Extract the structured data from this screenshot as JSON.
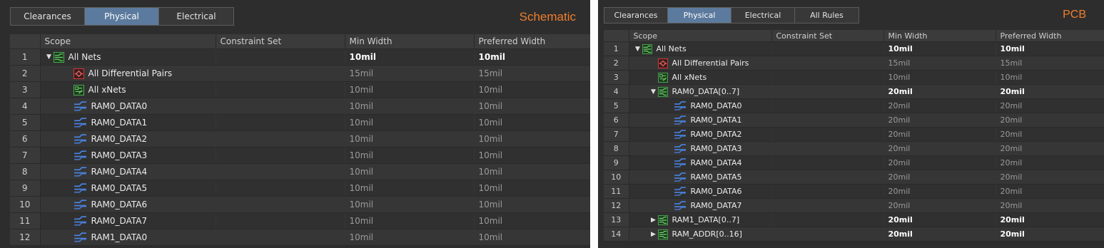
{
  "schematic": {
    "mode_label": "Schematic",
    "tabs": [
      {
        "label": "Clearances",
        "active": false
      },
      {
        "label": "Physical",
        "active": true
      },
      {
        "label": "Electrical",
        "active": false
      }
    ],
    "columns": [
      "Scope",
      "Constraint Set",
      "Min Width",
      "Preferred Width"
    ],
    "rows": [
      {
        "num": "1",
        "name": "All Nets",
        "icon": "net-class-icon",
        "expander": "down",
        "indent": 0,
        "min": "10mil",
        "pref": "10mil",
        "bright": true
      },
      {
        "num": "2",
        "name": "All Differential Pairs",
        "icon": "differential-pair-icon",
        "expander": "",
        "indent": 1,
        "min": "15mil",
        "pref": "15mil",
        "bright": false
      },
      {
        "num": "3",
        "name": "All xNets",
        "icon": "xnet-icon",
        "expander": "",
        "indent": 1,
        "min": "10mil",
        "pref": "10mil",
        "bright": false
      },
      {
        "num": "4",
        "name": "RAM0_DATA0",
        "icon": "net-icon",
        "expander": "",
        "indent": 1,
        "min": "10mil",
        "pref": "10mil",
        "bright": false
      },
      {
        "num": "5",
        "name": "RAM0_DATA1",
        "icon": "net-icon",
        "expander": "",
        "indent": 1,
        "min": "10mil",
        "pref": "10mil",
        "bright": false
      },
      {
        "num": "6",
        "name": "RAM0_DATA2",
        "icon": "net-icon",
        "expander": "",
        "indent": 1,
        "min": "10mil",
        "pref": "10mil",
        "bright": false
      },
      {
        "num": "7",
        "name": "RAM0_DATA3",
        "icon": "net-icon",
        "expander": "",
        "indent": 1,
        "min": "10mil",
        "pref": "10mil",
        "bright": false
      },
      {
        "num": "8",
        "name": "RAM0_DATA4",
        "icon": "net-icon",
        "expander": "",
        "indent": 1,
        "min": "10mil",
        "pref": "10mil",
        "bright": false
      },
      {
        "num": "9",
        "name": "RAM0_DATA5",
        "icon": "net-icon",
        "expander": "",
        "indent": 1,
        "min": "10mil",
        "pref": "10mil",
        "bright": false
      },
      {
        "num": "10",
        "name": "RAM0_DATA6",
        "icon": "net-icon",
        "expander": "",
        "indent": 1,
        "min": "10mil",
        "pref": "10mil",
        "bright": false
      },
      {
        "num": "11",
        "name": "RAM0_DATA7",
        "icon": "net-icon",
        "expander": "",
        "indent": 1,
        "min": "10mil",
        "pref": "10mil",
        "bright": false
      },
      {
        "num": "12",
        "name": "RAM1_DATA0",
        "icon": "net-icon",
        "expander": "",
        "indent": 1,
        "min": "10mil",
        "pref": "10mil",
        "bright": false
      }
    ]
  },
  "pcb": {
    "mode_label": "PCB",
    "tabs": [
      {
        "label": "Clearances",
        "active": false
      },
      {
        "label": "Physical",
        "active": true
      },
      {
        "label": "Electrical",
        "active": false
      },
      {
        "label": "All Rules",
        "active": false
      }
    ],
    "columns": [
      "Scope",
      "Constraint Set",
      "Min Width",
      "Preferred Width"
    ],
    "rows": [
      {
        "num": "1",
        "name": "All Nets",
        "icon": "net-class-icon",
        "expander": "down",
        "indent": 0,
        "min": "10mil",
        "pref": "10mil",
        "bright": true
      },
      {
        "num": "2",
        "name": "All Differential Pairs",
        "icon": "differential-pair-icon",
        "expander": "",
        "indent": 1,
        "min": "15mil",
        "pref": "15mil",
        "bright": false
      },
      {
        "num": "3",
        "name": "All xNets",
        "icon": "xnet-icon",
        "expander": "",
        "indent": 1,
        "min": "10mil",
        "pref": "10mil",
        "bright": false
      },
      {
        "num": "4",
        "name": "RAM0_DATA[0..7]",
        "icon": "net-class-icon",
        "expander": "down",
        "indent": 1,
        "min": "20mil",
        "pref": "20mil",
        "bright": true
      },
      {
        "num": "5",
        "name": "RAM0_DATA0",
        "icon": "net-icon",
        "expander": "",
        "indent": 2,
        "min": "20mil",
        "pref": "20mil",
        "bright": false
      },
      {
        "num": "6",
        "name": "RAM0_DATA1",
        "icon": "net-icon",
        "expander": "",
        "indent": 2,
        "min": "20mil",
        "pref": "20mil",
        "bright": false
      },
      {
        "num": "7",
        "name": "RAM0_DATA2",
        "icon": "net-icon",
        "expander": "",
        "indent": 2,
        "min": "20mil",
        "pref": "20mil",
        "bright": false
      },
      {
        "num": "8",
        "name": "RAM0_DATA3",
        "icon": "net-icon",
        "expander": "",
        "indent": 2,
        "min": "20mil",
        "pref": "20mil",
        "bright": false
      },
      {
        "num": "9",
        "name": "RAM0_DATA4",
        "icon": "net-icon",
        "expander": "",
        "indent": 2,
        "min": "20mil",
        "pref": "20mil",
        "bright": false
      },
      {
        "num": "10",
        "name": "RAM0_DATA5",
        "icon": "net-icon",
        "expander": "",
        "indent": 2,
        "min": "20mil",
        "pref": "20mil",
        "bright": false
      },
      {
        "num": "11",
        "name": "RAM0_DATA6",
        "icon": "net-icon",
        "expander": "",
        "indent": 2,
        "min": "20mil",
        "pref": "20mil",
        "bright": false
      },
      {
        "num": "12",
        "name": "RAM0_DATA7",
        "icon": "net-icon",
        "expander": "",
        "indent": 2,
        "min": "20mil",
        "pref": "20mil",
        "bright": false
      },
      {
        "num": "13",
        "name": "RAM1_DATA[0..7]",
        "icon": "net-class-icon",
        "expander": "right",
        "indent": 1,
        "min": "20mil",
        "pref": "20mil",
        "bright": true
      },
      {
        "num": "14",
        "name": "RAM_ADDR[0..16]",
        "icon": "net-class-icon",
        "expander": "right",
        "indent": 1,
        "min": "20mil",
        "pref": "20mil",
        "bright": true
      }
    ]
  },
  "colors": {
    "background": "#2d2d2d",
    "active_tab": "#5b7a9d",
    "mode_label": "#f07e2c",
    "net_icon": "#4a86e8",
    "net_class_icon": "#4caf50",
    "diff_pair_icon": "#e53935"
  }
}
